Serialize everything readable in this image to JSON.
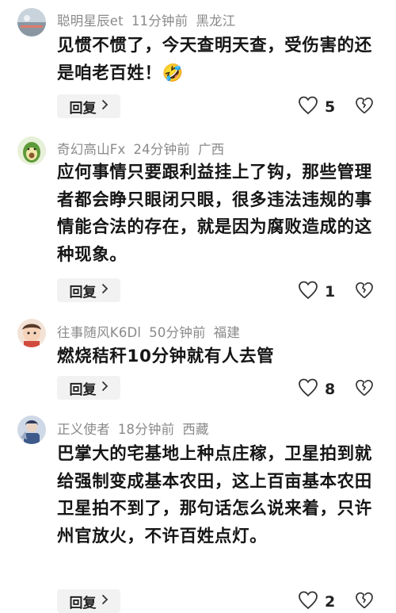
{
  "comments": [
    {
      "username": "聪明星辰et",
      "time": "11分钟前",
      "location": "黑龙江",
      "text": "见惯不惯了，今天查明天查，受伤害的还是咱老百姓！🤣",
      "reply_label": "回复",
      "likes": "5"
    },
    {
      "username": "奇幻高山Fx",
      "time": "24分钟前",
      "location": "广西",
      "text": "应何事情只要跟利益挂上了钩，那些管理者都会睁只眼闭只眼，很多违法违规的事情能合法的存在，就是因为腐败造成的这种现象。",
      "reply_label": "回复",
      "likes": "1"
    },
    {
      "username": "往事随风K6Dl",
      "time": "50分钟前",
      "location": "福建",
      "text": "燃烧秸秆10分钟就有人去管",
      "reply_label": "回复",
      "likes": "8"
    },
    {
      "username": "正义使者",
      "time": "18分钟前",
      "location": "西藏",
      "text": "巴掌大的宅基地上种点庄稼，卫星拍到就给强制变成基本农田，这上百亩基本农田卫星拍不到了，那句话怎么说来着，只许州官放火，不许百姓点灯。",
      "reply_label": "回复",
      "likes": "2"
    }
  ],
  "icons": {
    "reply_chevron": "chevron-right-icon",
    "like": "heart-outline-icon",
    "dislike": "broken-heart-icon"
  },
  "colors": {
    "meta_text": "#8a8a8a",
    "body_text": "#161616",
    "reply_bg": "#f2f2f2"
  }
}
